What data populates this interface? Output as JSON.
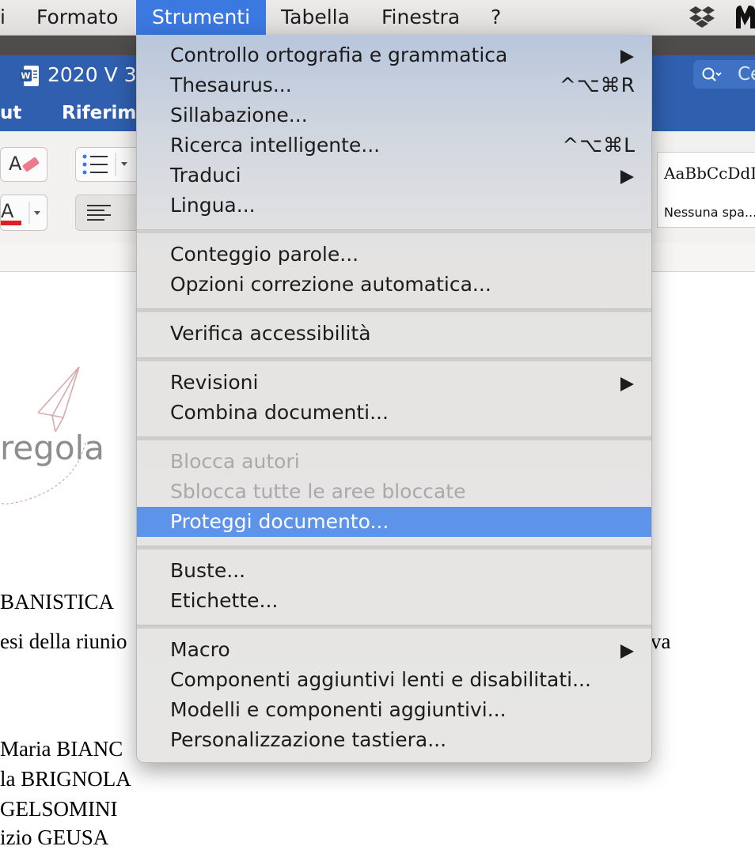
{
  "menubar": {
    "items": [
      {
        "label": "i"
      },
      {
        "label": "Formato"
      },
      {
        "label": "Strumenti"
      },
      {
        "label": "Tabella"
      },
      {
        "label": "Finestra"
      },
      {
        "label": "?"
      }
    ],
    "active_item": "Strumenti",
    "status_icons": [
      "dropbox-icon",
      "malwarebytes-icon"
    ]
  },
  "window": {
    "doc_title": "2020 V 3",
    "search_placeholder": "Ce",
    "tabs": [
      {
        "label": "ut"
      },
      {
        "label": "Riferime"
      }
    ],
    "style_gallery": {
      "sample": "AaBbCcDdI",
      "style_name": "Nessuna spa..."
    }
  },
  "document": {
    "logo_text": "regola",
    "lines": [
      {
        "text": "BANISTICA"
      },
      {
        "text": "esi della riunio"
      },
      {
        "text": "va"
      },
      {
        "text": " Maria BIANC"
      },
      {
        "text": "la BRIGNOLA"
      },
      {
        "text": " GELSOMINI"
      },
      {
        "text": "izio GEUSA"
      }
    ]
  },
  "menu": {
    "groups": [
      {
        "items": [
          {
            "label": "Controllo ortografia e grammatica",
            "submenu": true
          },
          {
            "label": "Thesaurus...",
            "shortcut": "^⌥⌘R"
          },
          {
            "label": "Sillabazione..."
          },
          {
            "label": "Ricerca intelligente...",
            "shortcut": "^⌥⌘L"
          },
          {
            "label": "Traduci",
            "submenu": true
          },
          {
            "label": "Lingua..."
          }
        ]
      },
      {
        "items": [
          {
            "label": "Conteggio parole..."
          },
          {
            "label": "Opzioni correzione automatica..."
          }
        ]
      },
      {
        "items": [
          {
            "label": "Verifica accessibilità"
          }
        ]
      },
      {
        "items": [
          {
            "label": "Revisioni",
            "submenu": true
          },
          {
            "label": "Combina documenti..."
          }
        ]
      },
      {
        "items": [
          {
            "label": "Blocca autori",
            "disabled": true
          },
          {
            "label": "Sblocca tutte le aree bloccate",
            "disabled": true
          },
          {
            "label": "Proteggi documento...",
            "highlighted": true
          }
        ]
      },
      {
        "items": [
          {
            "label": "Buste..."
          },
          {
            "label": "Etichette..."
          }
        ]
      },
      {
        "items": [
          {
            "label": "Macro",
            "submenu": true
          },
          {
            "label": "Componenti aggiuntivi lenti e disabilitati..."
          },
          {
            "label": "Modelli e componenti aggiuntivi..."
          },
          {
            "label": "Personalizzazione tastiera..."
          }
        ]
      }
    ]
  },
  "colors": {
    "menu_highlight": "#5e93ea",
    "menubar_active": "#3b78e0",
    "ribbon_blue": "#2f5fae",
    "disabled_text": "#a9a9a9"
  }
}
